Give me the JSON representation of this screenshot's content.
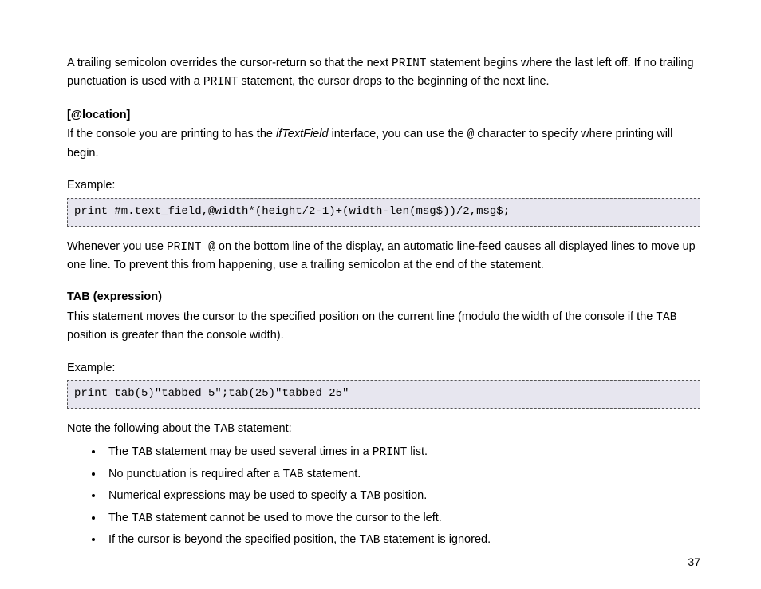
{
  "intro": {
    "p1a": "A trailing semicolon overrides the cursor-return so that the next ",
    "p1_code1": "PRINT",
    "p1b": " statement begins where the last left off. If no trailing punctuation is used with a ",
    "p1_code2": "PRINT",
    "p1c": " statement, the cursor drops to the beginning of the next line."
  },
  "loc": {
    "head": "[@location]",
    "p_a": "If the console you are printing to has the ",
    "p_em": "ifTextField",
    "p_b": " interface, you can use the ",
    "p_code": "@",
    "p_c": " character to specify where printing will begin.",
    "example_label": "Example:",
    "code": "print #m.text_field,@width*(height/2-1)+(width-len(msg$))/2,msg$;",
    "after_a": "Whenever you use ",
    "after_code": "PRINT @",
    "after_b": " on the bottom line of the display, an automatic line-feed causes all displayed lines to move up one line. To prevent this from happening, use a trailing semicolon at the end of the statement."
  },
  "tab": {
    "head": "TAB (expression)",
    "p_a": "This statement moves the cursor to the specified position on the current line (modulo the width of the console if the ",
    "p_code": "TAB",
    "p_b": " position is greater than the console width).",
    "example_label": "Example:",
    "code": "print tab(5)\"tabbed 5\";tab(25)\"tabbed 25\"",
    "note_a": "Note the following about the ",
    "note_code": "TAB",
    "note_b": "  statement:",
    "bullets": [
      {
        "a": "The ",
        "c1": "TAB",
        "b": " statement may be used several times in a ",
        "c2": "PRINT",
        "d": " list."
      },
      {
        "a": "No punctuation is required after a ",
        "c1": "TAB",
        "b": " statement.",
        "c2": "",
        "d": ""
      },
      {
        "a": "Numerical expressions may be used to specify a ",
        "c1": "TAB",
        "b": " position.",
        "c2": "",
        "d": ""
      },
      {
        "a": "The ",
        "c1": "TAB",
        "b": " statement cannot be used to move the cursor to the left.",
        "c2": "",
        "d": ""
      },
      {
        "a": "If the cursor is beyond the specified position, the ",
        "c1": "TAB",
        "b": " statement is ignored.",
        "c2": "",
        "d": ""
      }
    ]
  },
  "page_number": "37"
}
